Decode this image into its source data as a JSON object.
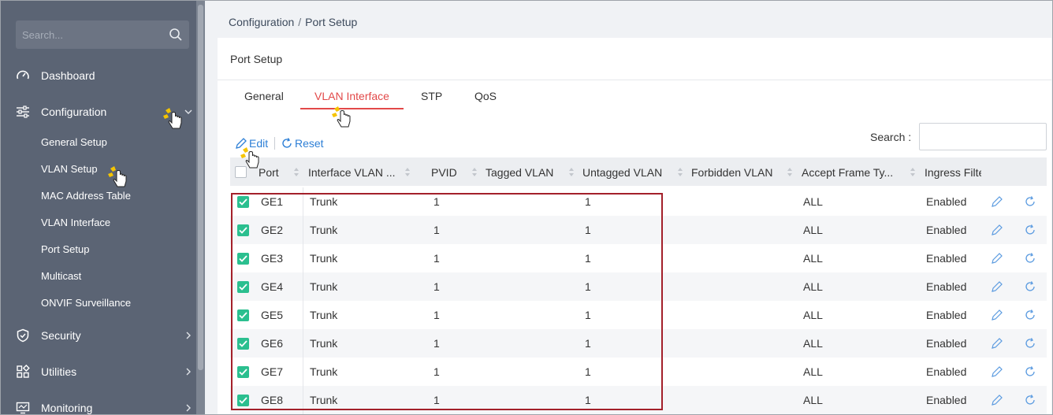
{
  "sidebar": {
    "search_placeholder": "Search...",
    "items": [
      {
        "label": "Dashboard"
      },
      {
        "label": "Configuration"
      },
      {
        "label": "Security"
      },
      {
        "label": "Utilities"
      },
      {
        "label": "Monitoring"
      }
    ],
    "sub_items": [
      {
        "label": "General Setup"
      },
      {
        "label": "VLAN Setup"
      },
      {
        "label": "MAC Address Table"
      },
      {
        "label": "VLAN Interface"
      },
      {
        "label": "Port Setup"
      },
      {
        "label": "Multicast"
      },
      {
        "label": "ONVIF Surveillance"
      }
    ]
  },
  "breadcrumb": {
    "parent": "Configuration",
    "separator": "/",
    "current": "Port Setup"
  },
  "card": {
    "title": "Port Setup"
  },
  "tabs": [
    {
      "label": "General"
    },
    {
      "label": "VLAN Interface",
      "active": true
    },
    {
      "label": "STP"
    },
    {
      "label": "QoS"
    }
  ],
  "toolbar": {
    "edit_label": "Edit",
    "reset_label": "Reset",
    "search_label": "Search :"
  },
  "table": {
    "columns": [
      "Port",
      "Interface VLAN ...",
      "PVID",
      "Tagged VLAN",
      "Untagged VLAN",
      "Forbidden VLAN",
      "Accept Frame Ty...",
      "Ingress Filte"
    ],
    "rows": [
      {
        "port": "GE1",
        "mode": "Trunk",
        "pvid": "1",
        "tagged": "",
        "untagged": "1",
        "forbidden": "",
        "accept": "ALL",
        "ingress": "Enabled"
      },
      {
        "port": "GE2",
        "mode": "Trunk",
        "pvid": "1",
        "tagged": "",
        "untagged": "1",
        "forbidden": "",
        "accept": "ALL",
        "ingress": "Enabled"
      },
      {
        "port": "GE3",
        "mode": "Trunk",
        "pvid": "1",
        "tagged": "",
        "untagged": "1",
        "forbidden": "",
        "accept": "ALL",
        "ingress": "Enabled"
      },
      {
        "port": "GE4",
        "mode": "Trunk",
        "pvid": "1",
        "tagged": "",
        "untagged": "1",
        "forbidden": "",
        "accept": "ALL",
        "ingress": "Enabled"
      },
      {
        "port": "GE5",
        "mode": "Trunk",
        "pvid": "1",
        "tagged": "",
        "untagged": "1",
        "forbidden": "",
        "accept": "ALL",
        "ingress": "Enabled"
      },
      {
        "port": "GE6",
        "mode": "Trunk",
        "pvid": "1",
        "tagged": "",
        "untagged": "1",
        "forbidden": "",
        "accept": "ALL",
        "ingress": "Enabled"
      },
      {
        "port": "GE7",
        "mode": "Trunk",
        "pvid": "1",
        "tagged": "",
        "untagged": "1",
        "forbidden": "",
        "accept": "ALL",
        "ingress": "Enabled"
      },
      {
        "port": "GE8",
        "mode": "Trunk",
        "pvid": "1",
        "tagged": "",
        "untagged": "1",
        "forbidden": "",
        "accept": "ALL",
        "ingress": "Enabled"
      }
    ]
  },
  "colors": {
    "accent": "#e24949",
    "link": "#2d7fd6",
    "checkbox": "#2bbf8f",
    "sidebar": "#5b6474",
    "highlight_box": "#a3202a"
  },
  "icons": {
    "dashboard": "gauge-icon",
    "configuration": "sliders-icon",
    "security": "shield-check-icon",
    "utilities": "grid-icon",
    "monitoring": "monitor-icon",
    "edit": "pencil-icon",
    "reset": "refresh-icon"
  }
}
